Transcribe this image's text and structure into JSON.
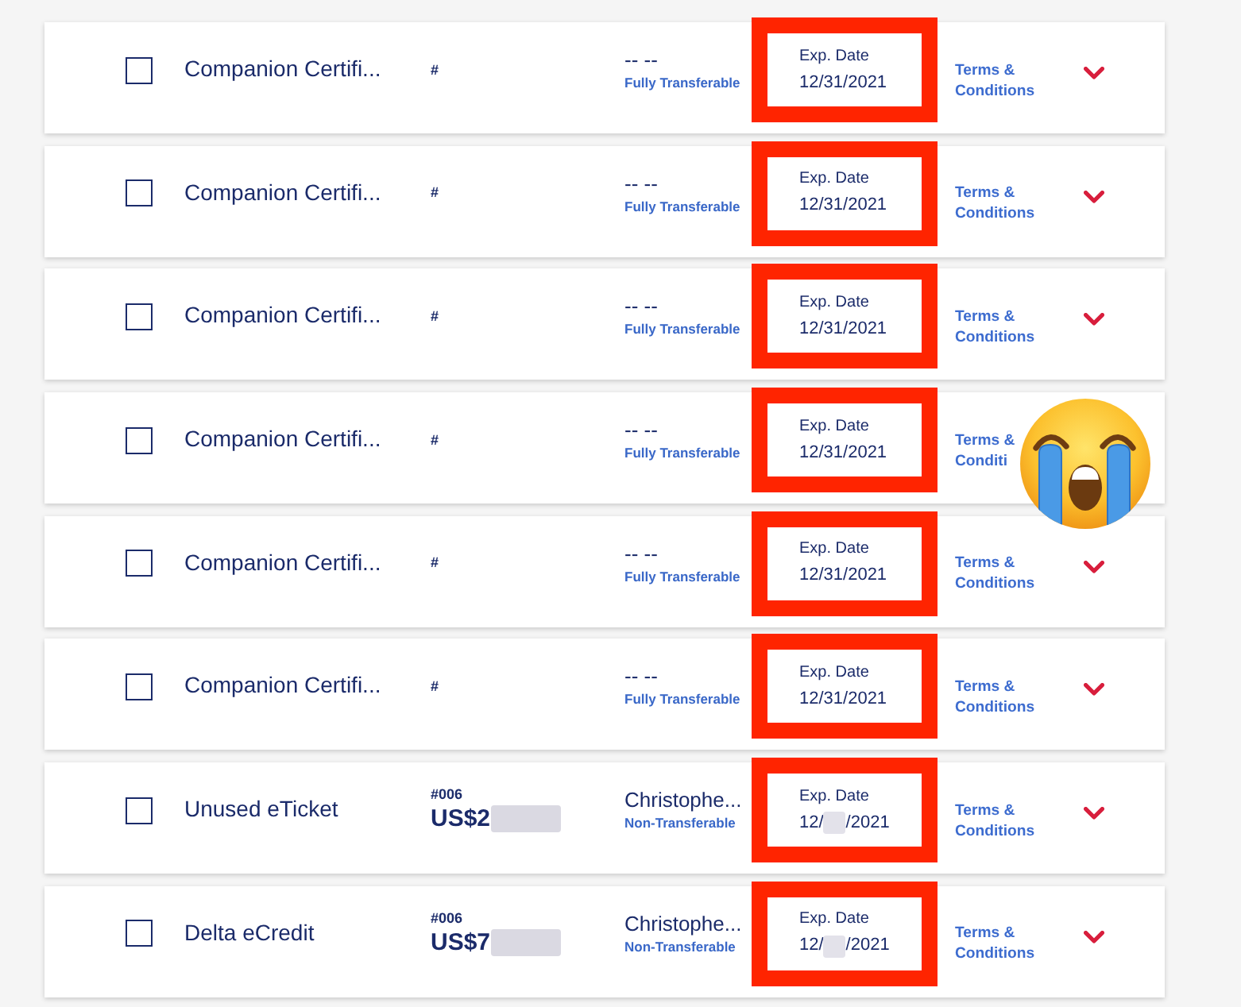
{
  "rows": [
    {
      "title": "Companion Certifi...",
      "checked": false,
      "number": "#",
      "holder": "-- --",
      "transfer": "Fully Transferable",
      "highlighted": true,
      "exp_label": "Exp. Date",
      "exp_date": "12/31/2021",
      "date_blurred": false,
      "terms": "Terms &\nConditions",
      "emoji_overlay": false
    },
    {
      "title": "Companion Certifi...",
      "checked": false,
      "number": "#",
      "holder": "-- --",
      "transfer": "Fully Transferable",
      "highlighted": true,
      "exp_label": "Exp. Date",
      "exp_date": "12/31/2021",
      "date_blurred": false,
      "terms": "Terms &\nConditions",
      "emoji_overlay": false
    },
    {
      "title": "Companion Certifi...",
      "checked": false,
      "number": "#",
      "holder": "-- --",
      "transfer": "Fully Transferable",
      "highlighted": true,
      "exp_label": "Exp. Date",
      "exp_date": "12/31/2021",
      "date_blurred": false,
      "terms": "Terms &\nConditions",
      "emoji_overlay": false
    },
    {
      "title": "Companion Certifi...",
      "checked": false,
      "number": "#",
      "holder": "-- --",
      "transfer": "Fully Transferable",
      "highlighted": true,
      "exp_label": "Exp. Date",
      "exp_date": "12/31/2021",
      "date_blurred": false,
      "terms": "Terms &\nConditi",
      "emoji_overlay": true
    },
    {
      "title": "Companion Certifi...",
      "checked": false,
      "number": "#",
      "holder": "-- --",
      "transfer": "Fully Transferable",
      "highlighted": true,
      "exp_label": "Exp. Date",
      "exp_date": "12/31/2021",
      "date_blurred": false,
      "terms": "Terms &\nConditions",
      "emoji_overlay": false
    },
    {
      "title": "Companion Certifi...",
      "checked": false,
      "number": "#",
      "holder": "-- --",
      "transfer": "Fully Transferable",
      "highlighted": true,
      "exp_label": "Exp. Date",
      "exp_date": "12/31/2021",
      "date_blurred": false,
      "terms": "Terms &\nConditions",
      "emoji_overlay": false
    },
    {
      "title": "Unused eTicket",
      "checked": false,
      "number": "#006",
      "amount": "US$2",
      "amount_blurred": true,
      "holder": "Christophe...",
      "transfer": "Non-Transferable",
      "highlighted": true,
      "exp_label": "Exp. Date",
      "exp_date": "12/",
      "date_blurred": true,
      "exp_date_end": "/2021",
      "terms": "Terms &\nConditions",
      "emoji_overlay": false
    },
    {
      "title": "Delta eCredit",
      "checked": false,
      "number": "#006",
      "amount": "US$7",
      "amount_blurred": true,
      "holder": "Christophe...",
      "transfer": "Non-Transferable",
      "highlighted": true,
      "exp_label": "Exp. Date",
      "exp_date": "12/",
      "date_blurred": true,
      "exp_date_end": "/2021",
      "terms": "Terms &\nConditions",
      "emoji_overlay": false
    }
  ]
}
